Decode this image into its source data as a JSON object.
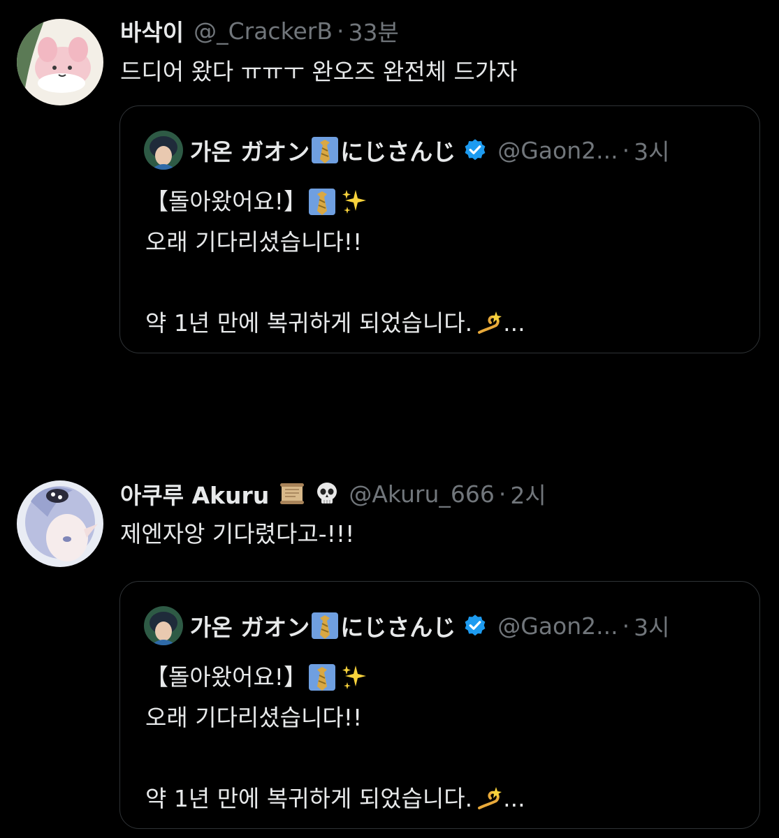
{
  "tweets": [
    {
      "display_name": "바삭이",
      "handle": "@_CrackerB",
      "separator": "·",
      "time": "33분",
      "text": "드디어 왔다 ㅠㅠㅜ 완오즈 완전체 드가자",
      "quote": {
        "display_name": "가온 ガオン",
        "name_suffix": "にじさんじ",
        "handle": "@Gaon2...",
        "separator": "·",
        "time": "3시",
        "lines": [
          "【돌아왔어요!】",
          "오래 기다리셨습니다!!",
          "",
          "약 1년 만에 복귀하게 되었습니다."
        ],
        "ellipsis": "..."
      }
    },
    {
      "display_name": "아쿠루 Akuru",
      "handle": "@Akuru_666",
      "separator": "·",
      "time": "2시",
      "text": "제엔자앙 기다렸다고-!!!",
      "quote": {
        "display_name": "가온 ガオン",
        "name_suffix": "にじさんじ",
        "handle": "@Gaon2...",
        "separator": "·",
        "time": "3시",
        "lines": [
          "【돌아왔어요!】",
          "오래 기다리셨습니다!!",
          "",
          "약 1년 만에 복귀하게 되었습니다."
        ],
        "ellipsis": "..."
      }
    }
  ],
  "icons": {
    "verified": "verified-badge-icon",
    "tie": "necktie-emoji",
    "sparkles": "sparkles-emoji",
    "dizzy": "dizzy-emoji",
    "scroll": "scroll-emoji",
    "skull": "skull-emoji"
  },
  "colors": {
    "background": "#000000",
    "text_primary": "#e7e9ea",
    "text_secondary": "#71767b",
    "border": "#2f3336",
    "verified_blue": "#1d9bf0"
  }
}
